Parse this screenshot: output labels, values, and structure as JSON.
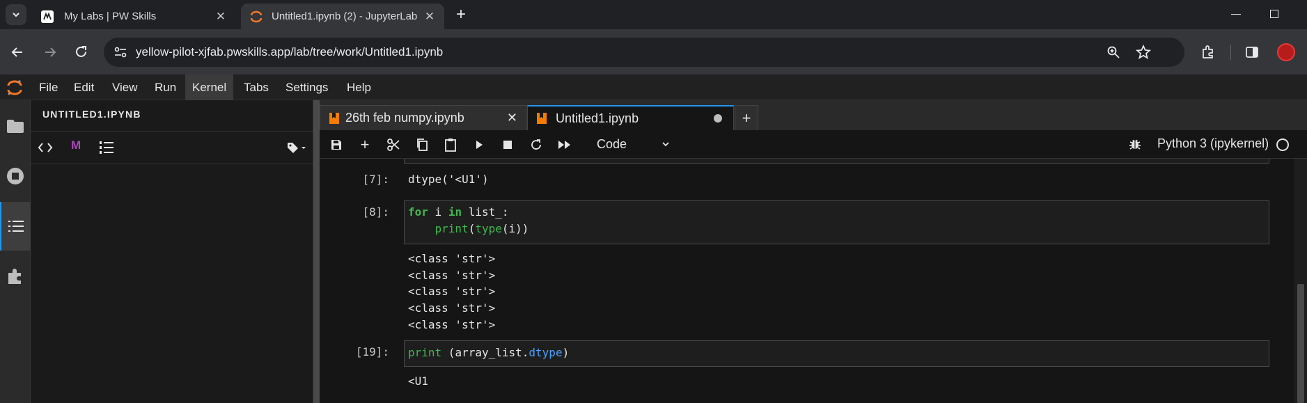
{
  "browser": {
    "tabs": [
      {
        "title": "My Labs | PW Skills",
        "active": false
      },
      {
        "title": "Untitled1.ipynb (2) - JupyterLab",
        "active": true
      }
    ],
    "new_tab": "+",
    "url": "yellow-pilot-xjfab.pwskills.app/lab/tree/work/Untitled1.ipynb"
  },
  "jupyter": {
    "menu": [
      "File",
      "Edit",
      "View",
      "Run",
      "Kernel",
      "Tabs",
      "Settings",
      "Help"
    ],
    "active_menu": "Kernel",
    "left_panel": {
      "title": "UNTITLED1.IPYNB",
      "markdown_glyph": "M"
    },
    "doc_tabs": [
      {
        "title": "26th feb numpy.ipynb",
        "active": false
      },
      {
        "title": "Untitled1.ipynb",
        "active": true
      }
    ],
    "add_tab": "+",
    "cell_type": "Code",
    "kernel_name": "Python 3 (ipykernel)"
  },
  "cells": {
    "c7": {
      "prompt": "[7]:",
      "output": "dtype('<U1')"
    },
    "c8": {
      "prompt": "[8]:",
      "code_line1": {
        "kw1": "for",
        "t1": " i ",
        "kw2": "in",
        "t2": " list_:"
      },
      "code_line2": {
        "indent": "    ",
        "fn1": "print",
        "t1": "(",
        "fn2": "type",
        "t2": "(i))"
      },
      "outputs": [
        "<class 'str'>",
        "<class 'str'>",
        "<class 'str'>",
        "<class 'str'>",
        "<class 'str'>"
      ]
    },
    "c19": {
      "prompt": "[19]:",
      "code": {
        "fn": "print",
        "t1": " (array_list.",
        "attr": "dtype",
        "t2": ")"
      },
      "output": "<U1"
    }
  },
  "colors": {
    "accent": "#2196f3",
    "keyword": "#3fb950",
    "attribute": "#4aa3ff",
    "jupyter_orange": "#f37726"
  }
}
